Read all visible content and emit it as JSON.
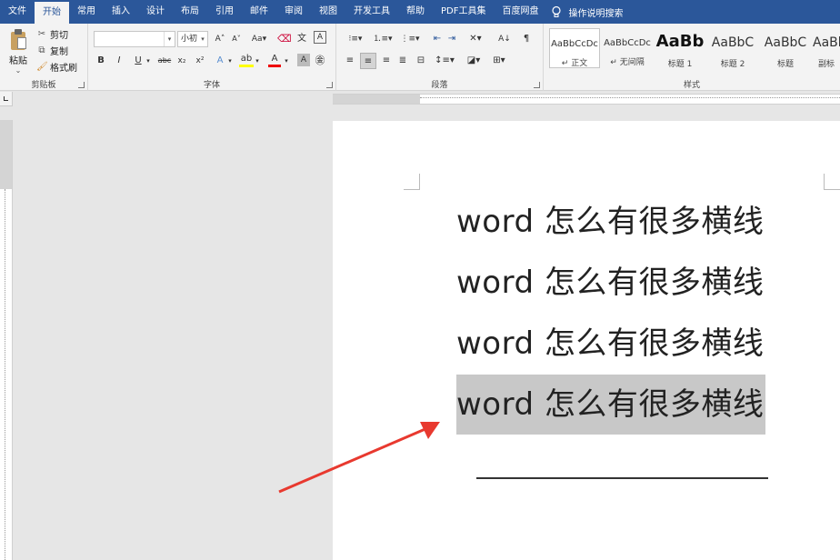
{
  "menu": {
    "items": [
      "文件",
      "开始",
      "常用",
      "插入",
      "设计",
      "布局",
      "引用",
      "邮件",
      "审阅",
      "视图",
      "开发工具",
      "帮助",
      "PDF工具集",
      "百度网盘"
    ],
    "active": "开始",
    "tell_me": "操作说明搜索"
  },
  "ribbon": {
    "clipboard": {
      "label": "剪贴板",
      "paste": "粘贴",
      "cut": "剪切",
      "copy": "复制",
      "format_painter": "格式刷"
    },
    "font": {
      "label": "字体",
      "font_name": "",
      "font_size": "小初"
    },
    "paragraph": {
      "label": "段落"
    },
    "styles": {
      "label": "样式",
      "items": [
        {
          "sample": "AaBbCcDc",
          "name": "正文"
        },
        {
          "sample": "AaBbCcDc",
          "name": "无间隔"
        },
        {
          "sample": "AaBb",
          "name": "标题 1"
        },
        {
          "sample": "AaBbC",
          "name": "标题 2"
        },
        {
          "sample": "AaBbC",
          "name": "标题"
        },
        {
          "sample": "AaBb",
          "name": "副标"
        }
      ]
    }
  },
  "document": {
    "lines": [
      "word 怎么有很多横线",
      "word 怎么有很多横线",
      "word 怎么有很多横线",
      "word 怎么有很多横线"
    ],
    "selected_line_index": 3,
    "horizontal_rule": true
  },
  "colors": {
    "titlebar": "#2b579a",
    "ribbon_bg": "#f3f3f3",
    "canvas_bg": "#e6e6e6",
    "selection": "#c8c8c8",
    "arrow": "#e8392f"
  }
}
